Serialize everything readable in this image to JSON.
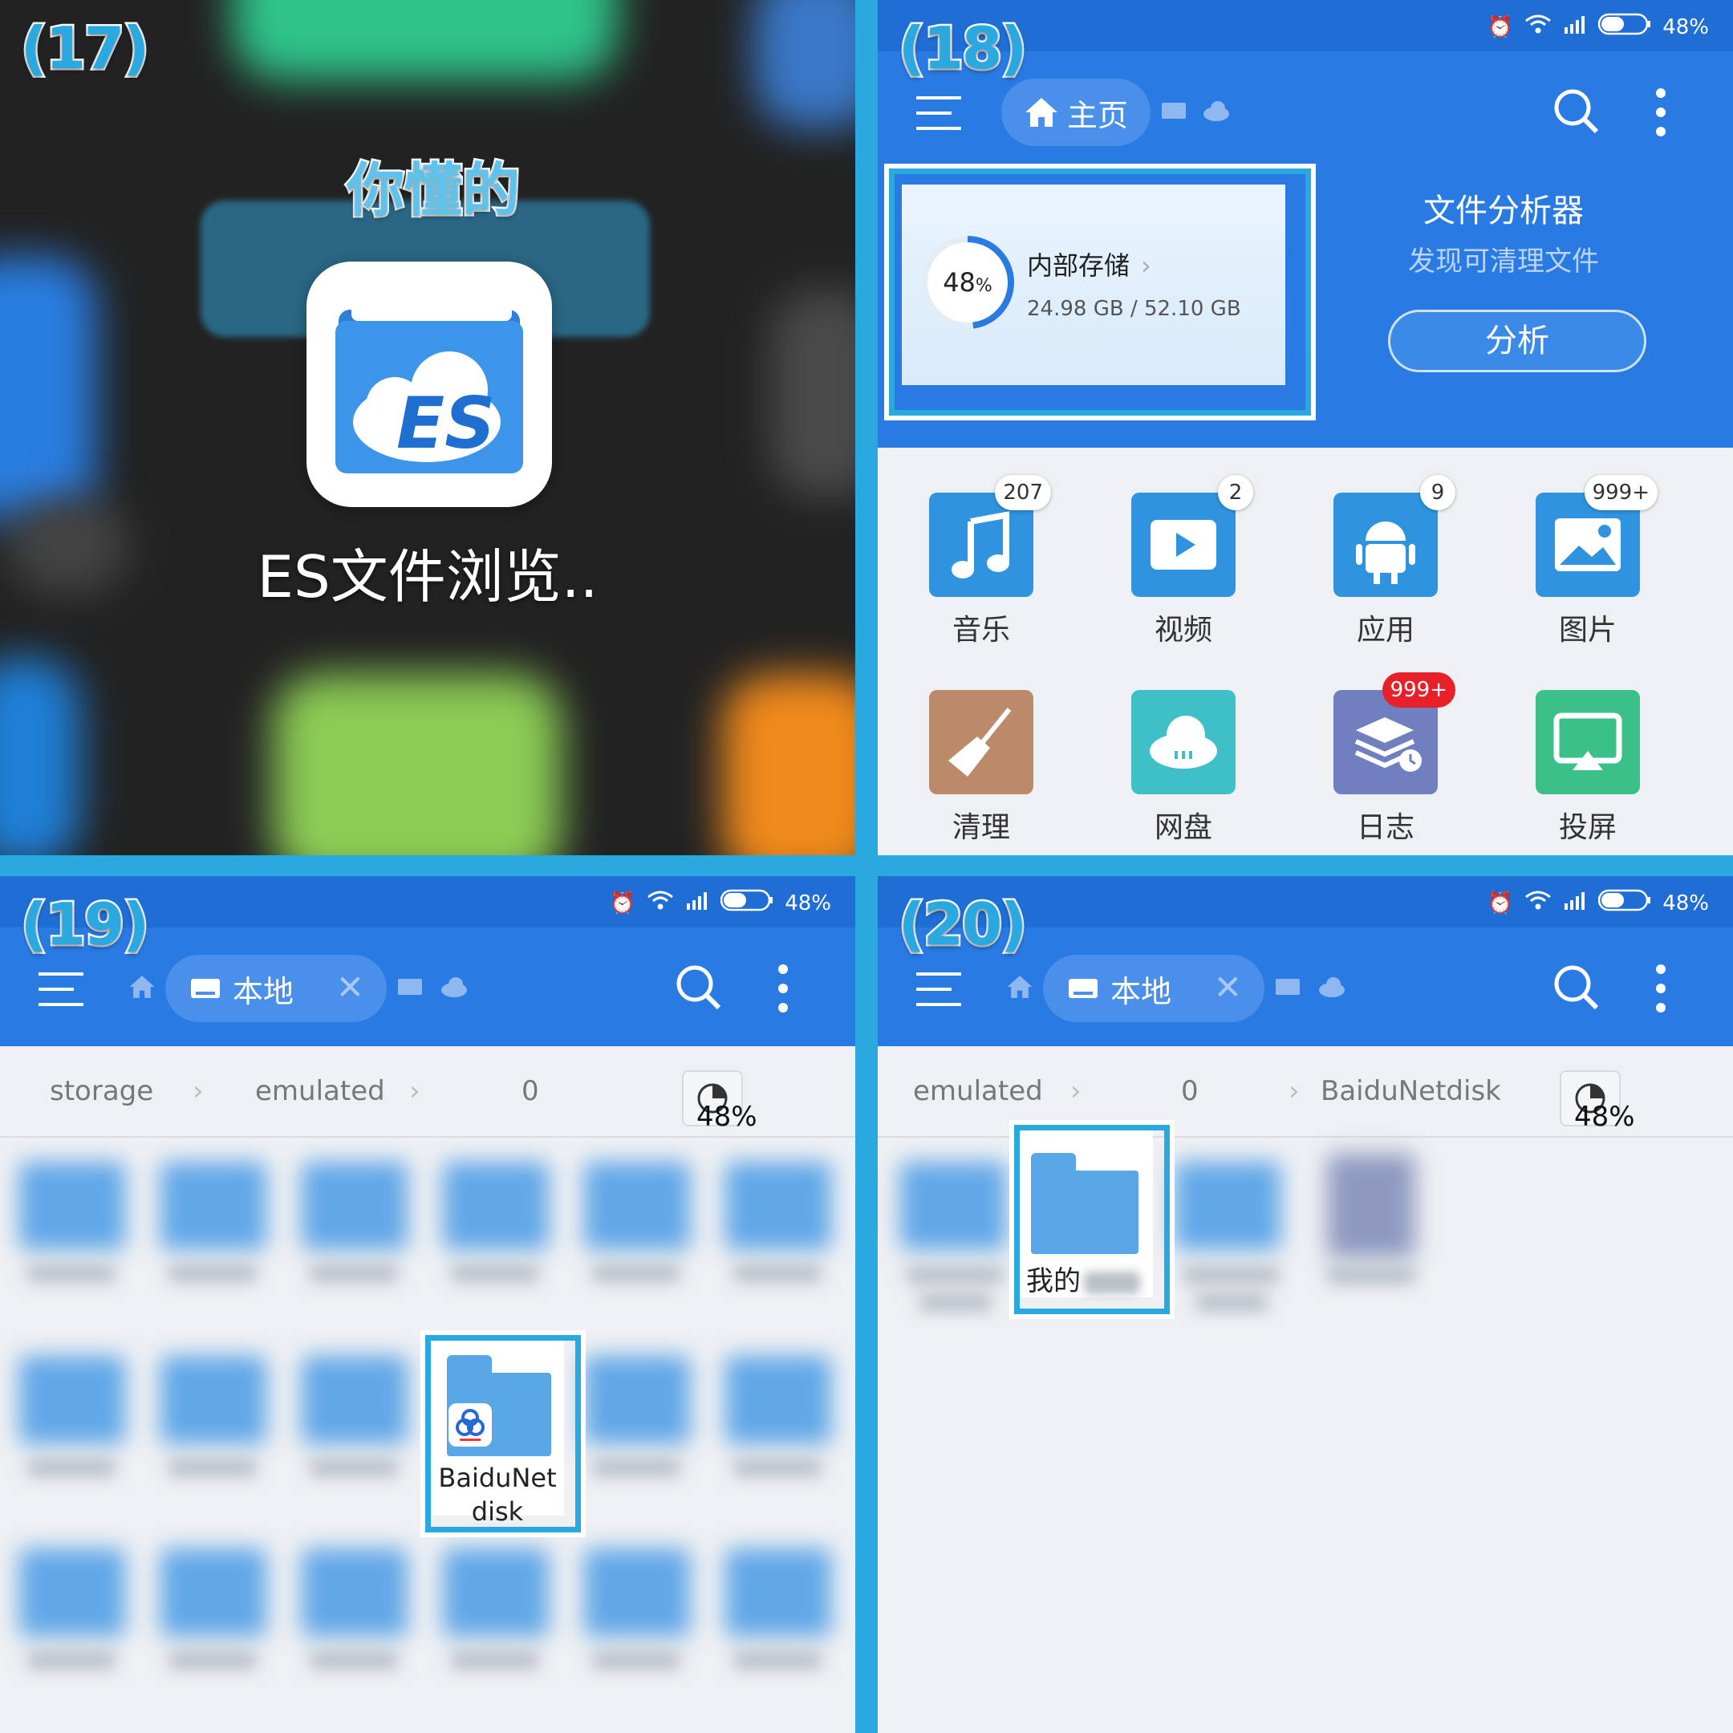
{
  "steps": [
    "(17)",
    "(18)",
    "(19)",
    "(20)"
  ],
  "q1": {
    "caption": "你懂的",
    "app_label": "ES文件浏览.."
  },
  "status": {
    "battery": "48%"
  },
  "q2": {
    "tab_home": "主页",
    "storage": {
      "title": "内部存储",
      "percent": "48",
      "percent_unit": "%",
      "usage": "24.98 GB / 52.10 GB",
      "fraction": 0.48
    },
    "analyzer": {
      "title": "文件分析器",
      "subtitle": "发现可清理文件",
      "button": "分析"
    },
    "categories": [
      {
        "label": "音乐",
        "badge": "207",
        "color": "#2f93df",
        "icon": "music-icon"
      },
      {
        "label": "视频",
        "badge": "2",
        "color": "#2f93df",
        "icon": "video-icon"
      },
      {
        "label": "应用",
        "badge": "9",
        "color": "#2f93df",
        "icon": "android-icon"
      },
      {
        "label": "图片",
        "badge": "999+",
        "color": "#2f93df",
        "icon": "image-icon"
      },
      {
        "label": "清理",
        "badge": "",
        "color": "#bb8a6a",
        "icon": "broom-icon"
      },
      {
        "label": "网盘",
        "badge": "",
        "color": "#3fc0c9",
        "icon": "cloud-icon"
      },
      {
        "label": "日志",
        "badge": "999+",
        "color": "#6f7fbf",
        "icon": "log-icon"
      },
      {
        "label": "投屏",
        "badge": "",
        "color": "#3cc08a",
        "icon": "cast-icon"
      }
    ]
  },
  "q3": {
    "tab_local": "本地",
    "path": [
      "storage",
      "emulated",
      "0"
    ],
    "usage": "48%",
    "highlight_folder": "BaiduNet\ndisk"
  },
  "q4": {
    "tab_local": "本地",
    "path": [
      "emulated",
      "0",
      "BaiduNetdisk"
    ],
    "usage": "48%",
    "highlight_folder": "我的"
  }
}
